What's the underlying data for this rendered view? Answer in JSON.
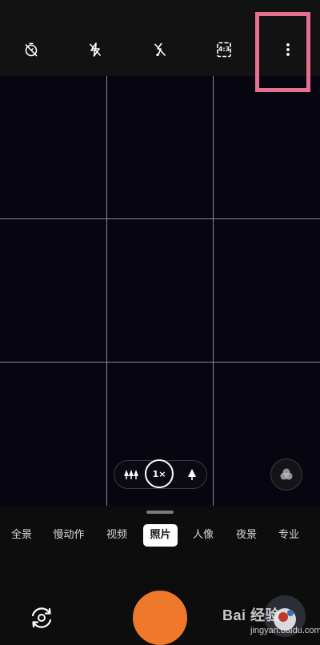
{
  "top_bar": {
    "icons": [
      "timer-off-icon",
      "flash-off-icon",
      "live-photo-off-icon",
      "aspect-ratio-icon",
      "more-options-icon"
    ],
    "aspect_ratio_label": "4:3"
  },
  "zoom_control": {
    "one_x_label": "1×",
    "icons": [
      "wide-trees-icon",
      "tele-tree-icon"
    ]
  },
  "modes": {
    "items": [
      {
        "label": "全景"
      },
      {
        "label": "慢动作"
      },
      {
        "label": "视频"
      },
      {
        "label": "照片"
      },
      {
        "label": "人像"
      },
      {
        "label": "夜景"
      },
      {
        "label": "专业"
      }
    ],
    "active": "照片"
  },
  "bottom_bar": {
    "icons": [
      "switch-camera-icon",
      "shutter-button",
      "gallery-thumbnail"
    ]
  },
  "watermark": {
    "brand": "Bai 经验",
    "url": "jingyan.baidu.com"
  },
  "colors": {
    "shutter": "#f0782a",
    "highlight_box": "#e5708f",
    "viewfinder": "#07050f"
  }
}
